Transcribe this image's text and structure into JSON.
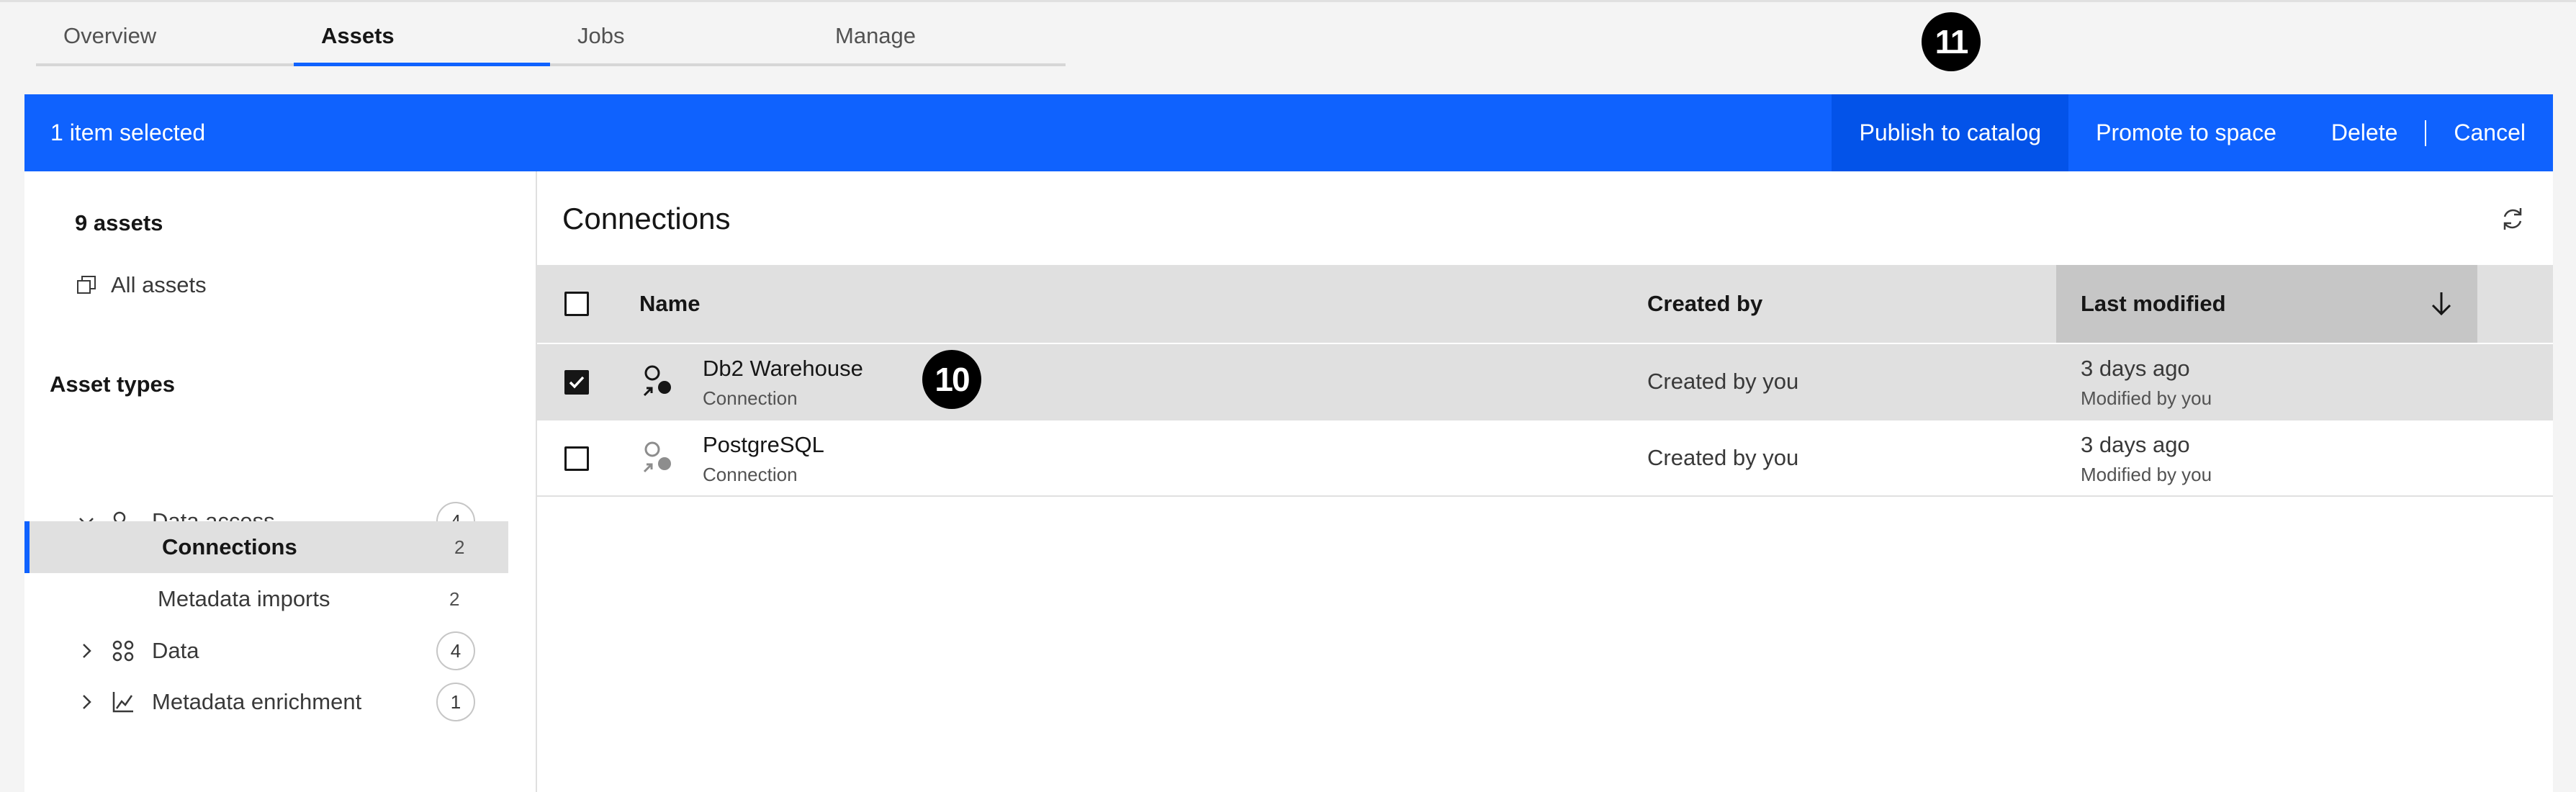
{
  "tabs": [
    {
      "label": "Overview",
      "active": false
    },
    {
      "label": "Assets",
      "active": true
    },
    {
      "label": "Jobs",
      "active": false
    },
    {
      "label": "Manage",
      "active": false
    }
  ],
  "markers": {
    "top": "11",
    "row": "10"
  },
  "selection_bar": {
    "text": "1 item selected",
    "publish": "Publish to catalog",
    "promote": "Promote to space",
    "delete": "Delete",
    "cancel": "Cancel"
  },
  "sidebar": {
    "asset_count": "9 assets",
    "all_assets": "All assets",
    "types_heading": "Asset types",
    "groups": [
      {
        "label": "Data access",
        "count": "4",
        "expanded": true,
        "icon": "data-access-icon"
      },
      {
        "label": "Connections",
        "count": "2",
        "active": true
      },
      {
        "label": "Metadata imports",
        "count": "2"
      },
      {
        "label": "Data",
        "count": "4",
        "expanded": false,
        "icon": "data-icon"
      },
      {
        "label": "Metadata enrichment",
        "count": "1",
        "expanded": false,
        "icon": "enrichment-icon"
      }
    ]
  },
  "main": {
    "title": "Connections",
    "columns": {
      "name": "Name",
      "created_by": "Created by",
      "last_modified": "Last modified"
    },
    "rows": [
      {
        "name": "Db2 Warehouse",
        "type": "Connection",
        "created_by": "Created by you",
        "modified": "3 days ago",
        "modified_by": "Modified by you",
        "selected": true
      },
      {
        "name": "PostgreSQL",
        "type": "Connection",
        "created_by": "Created by you",
        "modified": "3 days ago",
        "modified_by": "Modified by you",
        "selected": false
      }
    ]
  },
  "colors": {
    "accent": "#0f62fe",
    "accent_dark": "#0353e9",
    "selected_row": "#e0e0e0"
  }
}
